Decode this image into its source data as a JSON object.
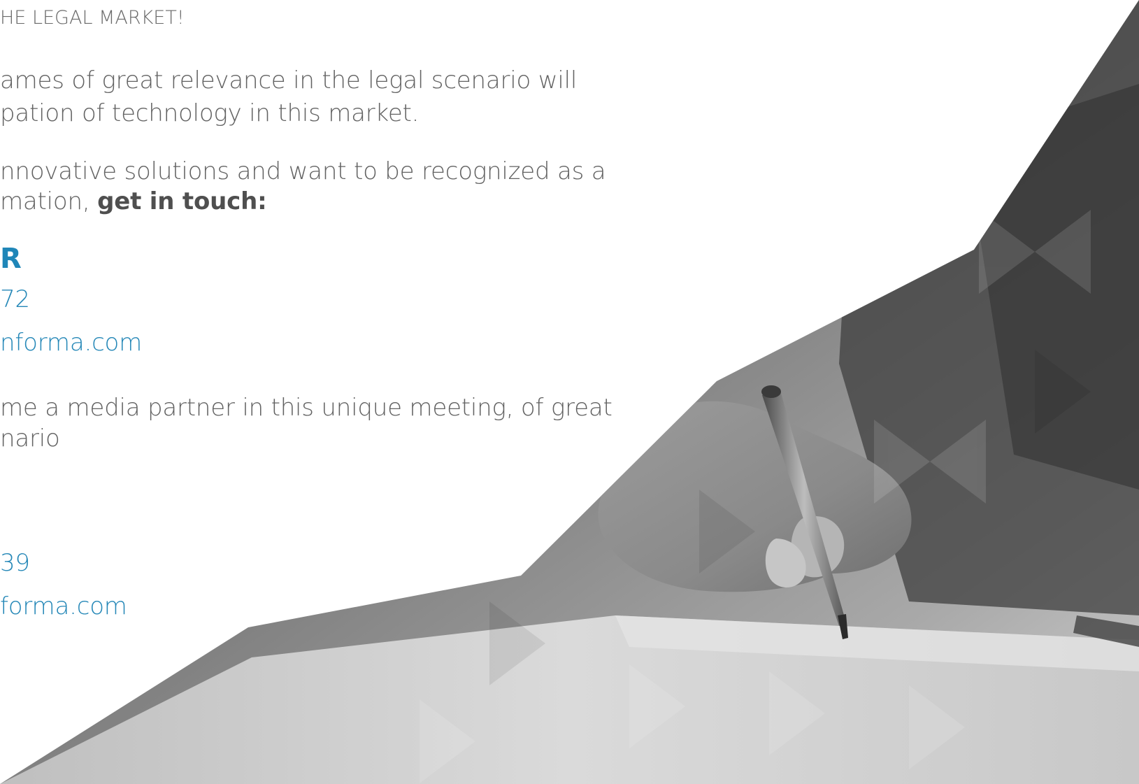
{
  "intro": {
    "heading": "HE LEGAL MARKET!",
    "para1": [
      "ames of great relevance in the legal scenario will",
      "pation of technology in this market."
    ],
    "para2_line1": "nnovative solutions and want to be recognized as a",
    "para2_line2_prefix": "mation, ",
    "para2_line2_bold": "get in touch:"
  },
  "contact_1": {
    "name_fragment": "R",
    "phone_fragment": "72",
    "email_fragment": "nforma.com"
  },
  "media_partner": {
    "lines": [
      "me a media partner in this unique meeting, of great",
      "nario"
    ]
  },
  "contact_2": {
    "phone_fragment": "39",
    "email_fragment": "forma.com"
  },
  "colors": {
    "accent": "#2487b7",
    "text": "#626262",
    "photo_tone": "#8c8c8c"
  },
  "decor": {
    "photo_subject": "hand-writing-with-pen-icon"
  }
}
